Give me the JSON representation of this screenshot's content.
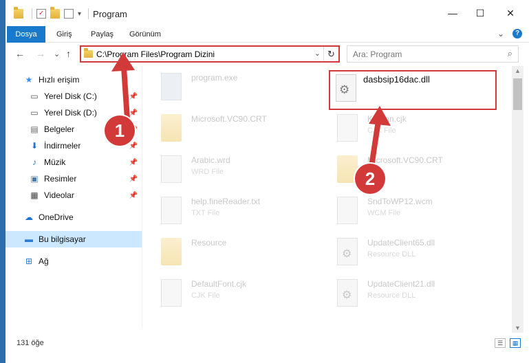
{
  "window": {
    "title": "Program",
    "minimize": "—",
    "maximize": "☐",
    "close": "✕"
  },
  "ribbon": {
    "tabs": [
      "Dosya",
      "Giriş",
      "Paylaş",
      "Görünüm"
    ],
    "expand": "⌄",
    "help": "?"
  },
  "nav": {
    "back": "←",
    "forward": "→",
    "recent": "⌄",
    "up": "↑"
  },
  "address": {
    "path": "C:\\Program Files\\Program Dizini",
    "dropdown": "⌄",
    "refresh": "↻"
  },
  "search": {
    "placeholder": "Ara: Program",
    "icon": "⌕"
  },
  "sidebar": {
    "items": [
      {
        "label": "Hızlı erişim",
        "icon": "★"
      },
      {
        "label": "Yerel Disk (C:)",
        "icon": "▭",
        "pin": "📌"
      },
      {
        "label": "Yerel Disk (D:)",
        "icon": "▭",
        "pin": "📌"
      },
      {
        "label": "Belgeler",
        "icon": "▤",
        "pin": "📌"
      },
      {
        "label": "İndirmeler",
        "icon": "⬇",
        "pin": "📌"
      },
      {
        "label": "Müzik",
        "icon": "♪",
        "pin": "📌"
      },
      {
        "label": "Resimler",
        "icon": "▣",
        "pin": "📌"
      },
      {
        "label": "Videolar",
        "icon": "▦",
        "pin": "📌"
      },
      {
        "label": "OneDrive",
        "icon": "☁"
      },
      {
        "label": "Bu bilgisayar",
        "icon": "▬"
      },
      {
        "label": "Ağ",
        "icon": "⊞"
      }
    ]
  },
  "files": [
    {
      "name": "program.exe",
      "type": ""
    },
    {
      "name": "dasbsip16dac.dll",
      "type": ""
    },
    {
      "name": "Microsoft.VC90.CRT",
      "type": ""
    },
    {
      "name": "Korean.cjk",
      "type": "CJK File"
    },
    {
      "name": "Arabic.wrd",
      "type": "WRD File"
    },
    {
      "name": "Microsoft.VC90.CRT",
      "type": ""
    },
    {
      "name": "help.fineReader.txt",
      "type": "TXT File"
    },
    {
      "name": "SndToWP12.wcm",
      "type": "WCM File"
    },
    {
      "name": "Resource",
      "type": ""
    },
    {
      "name": "UpdateClient65.dll",
      "type": "Resource DLL"
    },
    {
      "name": "DefaultFont.cjk",
      "type": "CJK File"
    },
    {
      "name": "UpdateClient21.dll",
      "type": "Resource DLL"
    }
  ],
  "status": {
    "count": "131 öğe"
  },
  "annotations": {
    "badge1": "1",
    "badge2": "2",
    "color": "#d23a3a"
  }
}
